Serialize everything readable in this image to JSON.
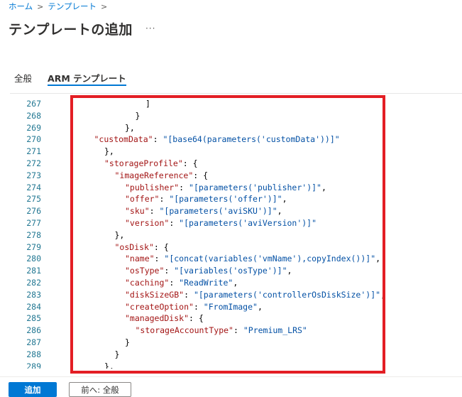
{
  "breadcrumb": {
    "home": "ホーム",
    "templates": "テンプレート",
    "separator": ">"
  },
  "header": {
    "title": "テンプレートの追加",
    "more": "···"
  },
  "tabs": [
    {
      "label": "全般",
      "active": false
    },
    {
      "label": "ARM テンプレート",
      "active": true
    }
  ],
  "editor": {
    "lines": [
      {
        "n": "267",
        "indent": 6,
        "tokens": [
          {
            "t": "]",
            "c": "p"
          }
        ]
      },
      {
        "n": "268",
        "indent": 5,
        "tokens": [
          {
            "t": "}",
            "c": "p"
          }
        ]
      },
      {
        "n": "269",
        "indent": 4,
        "tokens": [
          {
            "t": "},",
            "c": "p"
          }
        ]
      },
      {
        "n": "270",
        "indent": 1,
        "tokens": [
          {
            "t": "\"customData\"",
            "c": "k"
          },
          {
            "t": ": ",
            "c": "p"
          },
          {
            "t": "\"[base64(parameters('customData'))]\"",
            "c": "s"
          }
        ]
      },
      {
        "n": "271",
        "indent": 2,
        "tokens": [
          {
            "t": "},",
            "c": "p"
          }
        ]
      },
      {
        "n": "272",
        "indent": 2,
        "tokens": [
          {
            "t": "\"storageProfile\"",
            "c": "k"
          },
          {
            "t": ": {",
            "c": "p"
          }
        ]
      },
      {
        "n": "273",
        "indent": 3,
        "tokens": [
          {
            "t": "\"imageReference\"",
            "c": "k"
          },
          {
            "t": ": {",
            "c": "p"
          }
        ]
      },
      {
        "n": "274",
        "indent": 4,
        "tokens": [
          {
            "t": "\"publisher\"",
            "c": "k"
          },
          {
            "t": ": ",
            "c": "p"
          },
          {
            "t": "\"[parameters('publisher')]\"",
            "c": "s"
          },
          {
            "t": ",",
            "c": "p"
          }
        ]
      },
      {
        "n": "275",
        "indent": 4,
        "tokens": [
          {
            "t": "\"offer\"",
            "c": "k"
          },
          {
            "t": ": ",
            "c": "p"
          },
          {
            "t": "\"[parameters('offer')]\"",
            "c": "s"
          },
          {
            "t": ",",
            "c": "p"
          }
        ]
      },
      {
        "n": "276",
        "indent": 4,
        "tokens": [
          {
            "t": "\"sku\"",
            "c": "k"
          },
          {
            "t": ": ",
            "c": "p"
          },
          {
            "t": "\"[parameters('aviSKU')]\"",
            "c": "s"
          },
          {
            "t": ",",
            "c": "p"
          }
        ]
      },
      {
        "n": "277",
        "indent": 4,
        "tokens": [
          {
            "t": "\"version\"",
            "c": "k"
          },
          {
            "t": ": ",
            "c": "p"
          },
          {
            "t": "\"[parameters('aviVersion')]\"",
            "c": "s"
          }
        ]
      },
      {
        "n": "278",
        "indent": 3,
        "tokens": [
          {
            "t": "},",
            "c": "p"
          }
        ]
      },
      {
        "n": "279",
        "indent": 3,
        "tokens": [
          {
            "t": "\"osDisk\"",
            "c": "k"
          },
          {
            "t": ": {",
            "c": "p"
          }
        ]
      },
      {
        "n": "280",
        "indent": 4,
        "tokens": [
          {
            "t": "\"name\"",
            "c": "k"
          },
          {
            "t": ": ",
            "c": "p"
          },
          {
            "t": "\"[concat(variables('vmName'),copyIndex())]\"",
            "c": "s"
          },
          {
            "t": ",",
            "c": "p"
          }
        ]
      },
      {
        "n": "281",
        "indent": 4,
        "tokens": [
          {
            "t": "\"osType\"",
            "c": "k"
          },
          {
            "t": ": ",
            "c": "p"
          },
          {
            "t": "\"[variables('osType')]\"",
            "c": "s"
          },
          {
            "t": ",",
            "c": "p"
          }
        ]
      },
      {
        "n": "282",
        "indent": 4,
        "tokens": [
          {
            "t": "\"caching\"",
            "c": "k"
          },
          {
            "t": ": ",
            "c": "p"
          },
          {
            "t": "\"ReadWrite\"",
            "c": "s"
          },
          {
            "t": ",",
            "c": "p"
          }
        ]
      },
      {
        "n": "283",
        "indent": 4,
        "tokens": [
          {
            "t": "\"diskSizeGB\"",
            "c": "k"
          },
          {
            "t": ": ",
            "c": "p"
          },
          {
            "t": "\"[parameters('controllerOsDiskSize')]\"",
            "c": "s"
          },
          {
            "t": ",",
            "c": "p"
          }
        ]
      },
      {
        "n": "284",
        "indent": 4,
        "tokens": [
          {
            "t": "\"createOption\"",
            "c": "k"
          },
          {
            "t": ": ",
            "c": "p"
          },
          {
            "t": "\"FromImage\"",
            "c": "s"
          },
          {
            "t": ",",
            "c": "p"
          }
        ]
      },
      {
        "n": "285",
        "indent": 4,
        "tokens": [
          {
            "t": "\"managedDisk\"",
            "c": "k"
          },
          {
            "t": ": {",
            "c": "p"
          }
        ]
      },
      {
        "n": "286",
        "indent": 5,
        "tokens": [
          {
            "t": "\"storageAccountType\"",
            "c": "k"
          },
          {
            "t": ": ",
            "c": "p"
          },
          {
            "t": "\"Premium_LRS\"",
            "c": "s"
          }
        ]
      },
      {
        "n": "287",
        "indent": 4,
        "tokens": [
          {
            "t": "}",
            "c": "p"
          }
        ]
      },
      {
        "n": "288",
        "indent": 3,
        "tokens": [
          {
            "t": "}",
            "c": "p"
          }
        ]
      },
      {
        "n": "289",
        "indent": 2,
        "tokens": [
          {
            "t": "},",
            "c": "p"
          }
        ]
      }
    ]
  },
  "footer": {
    "add_label": "追加",
    "prev_label": "前へ: 全般"
  },
  "colors": {
    "accent": "#0078d4",
    "highlight": "#e31e24",
    "json_key": "#a31515",
    "json_string": "#0451a5",
    "line_number": "#237893"
  }
}
